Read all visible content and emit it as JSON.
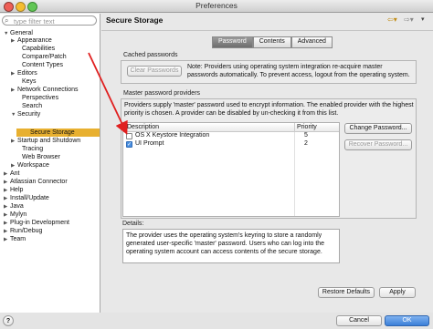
{
  "window": {
    "title": "Preferences"
  },
  "search": {
    "placeholder": "type filter text"
  },
  "tree": [
    {
      "label": "General",
      "expanded": true,
      "level": 0
    },
    {
      "label": "Appearance",
      "level": 1,
      "collapsed": true
    },
    {
      "label": "Capabilities",
      "level": 1
    },
    {
      "label": "Compare/Patch",
      "level": 1
    },
    {
      "label": "Content Types",
      "level": 1
    },
    {
      "label": "Editors",
      "level": 1,
      "collapsed": true
    },
    {
      "label": "Keys",
      "level": 1
    },
    {
      "label": "Network Connections",
      "level": 1,
      "collapsed": true
    },
    {
      "label": "Perspectives",
      "level": 1
    },
    {
      "label": "Search",
      "level": 1
    },
    {
      "label": "Security",
      "level": 1,
      "expanded": true
    },
    {
      "label": "Secure Storage",
      "level": 2,
      "selected": true
    },
    {
      "label": "Startup and Shutdown",
      "level": 1,
      "collapsed": true
    },
    {
      "label": "Tracing",
      "level": 1
    },
    {
      "label": "Web Browser",
      "level": 1
    },
    {
      "label": "Workspace",
      "level": 1,
      "collapsed": true
    },
    {
      "label": "Ant",
      "level": 0,
      "collapsed": true
    },
    {
      "label": "Atlassian Connector",
      "level": 0,
      "collapsed": true
    },
    {
      "label": "Help",
      "level": 0,
      "collapsed": true
    },
    {
      "label": "Install/Update",
      "level": 0,
      "collapsed": true
    },
    {
      "label": "Java",
      "level": 0,
      "collapsed": true
    },
    {
      "label": "Mylyn",
      "level": 0,
      "collapsed": true
    },
    {
      "label": "Plug-in Development",
      "level": 0,
      "collapsed": true
    },
    {
      "label": "Run/Debug",
      "level": 0,
      "collapsed": true
    },
    {
      "label": "Team",
      "level": 0,
      "collapsed": true
    }
  ],
  "page": {
    "title": "Secure Storage",
    "tabs": [
      "Password",
      "Contents",
      "Advanced"
    ],
    "cached": {
      "group_label": "Cached passwords",
      "button": "Clear Passwords",
      "note": "Note: Providers using operating system integration re-acquire master passwords automatically. To prevent access, logout from the operating system."
    },
    "master": {
      "group_label": "Master password providers",
      "description": "Providers supply 'master' password used to encrypt information. The enabled provider with the highest priority is chosen. A provider can be disabled by un-checking it from this list.",
      "columns": [
        "Description",
        "Priority"
      ],
      "rows": [
        {
          "description": "OS X Keystore Integration",
          "priority": "5",
          "checked": false
        },
        {
          "description": "UI Prompt",
          "priority": "2",
          "checked": true
        }
      ],
      "change_button": "Change Password...",
      "recover_button": "Recover Password..."
    },
    "details": {
      "label": "Details:",
      "text": "The provider uses the operating system's keyring to store a randomly generated user-specific 'master' password. Users who can log into the operating system account can access contents of the secure storage."
    },
    "restore_defaults": "Restore Defaults",
    "apply": "Apply"
  },
  "footer": {
    "cancel": "Cancel",
    "ok": "OK",
    "help": "?"
  },
  "colors": {
    "selection": "#e8b030",
    "ok_button": "#3b7fd8",
    "annotation_arrow": "#e02020"
  },
  "icons": {
    "help": "question-mark-icon",
    "nav_back": "back-arrow-icon",
    "nav_forward": "forward-arrow-icon",
    "menu": "view-menu-icon"
  }
}
